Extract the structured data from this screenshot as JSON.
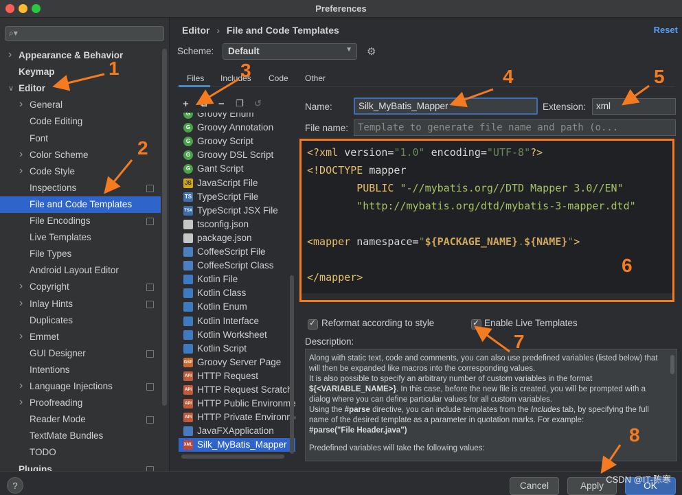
{
  "window": {
    "title": "Preferences"
  },
  "sidebar": {
    "search_placeholder": "",
    "items": [
      {
        "label": "Appearance & Behavior",
        "level": 0,
        "chevron": "right",
        "bold": true
      },
      {
        "label": "Keymap",
        "level": 0,
        "chevron": "",
        "bold": true
      },
      {
        "label": "Editor",
        "level": 0,
        "chevron": "down",
        "bold": true
      },
      {
        "label": "General",
        "level": 1,
        "chevron": "right"
      },
      {
        "label": "Code Editing",
        "level": 1,
        "chevron": ""
      },
      {
        "label": "Font",
        "level": 1,
        "chevron": ""
      },
      {
        "label": "Color Scheme",
        "level": 1,
        "chevron": "right"
      },
      {
        "label": "Code Style",
        "level": 1,
        "chevron": "right"
      },
      {
        "label": "Inspections",
        "level": 1,
        "chevron": "",
        "project": true
      },
      {
        "label": "File and Code Templates",
        "level": 1,
        "chevron": "",
        "selected": true
      },
      {
        "label": "File Encodings",
        "level": 1,
        "chevron": "",
        "project": true
      },
      {
        "label": "Live Templates",
        "level": 1,
        "chevron": ""
      },
      {
        "label": "File Types",
        "level": 1,
        "chevron": ""
      },
      {
        "label": "Android Layout Editor",
        "level": 1,
        "chevron": ""
      },
      {
        "label": "Copyright",
        "level": 1,
        "chevron": "right",
        "project": true
      },
      {
        "label": "Inlay Hints",
        "level": 1,
        "chevron": "right",
        "project": true
      },
      {
        "label": "Duplicates",
        "level": 1,
        "chevron": ""
      },
      {
        "label": "Emmet",
        "level": 1,
        "chevron": "right"
      },
      {
        "label": "GUI Designer",
        "level": 1,
        "chevron": "",
        "project": true
      },
      {
        "label": "Intentions",
        "level": 1,
        "chevron": ""
      },
      {
        "label": "Language Injections",
        "level": 1,
        "chevron": "right",
        "project": true
      },
      {
        "label": "Proofreading",
        "level": 1,
        "chevron": "right"
      },
      {
        "label": "Reader Mode",
        "level": 1,
        "chevron": "",
        "project": true
      },
      {
        "label": "TextMate Bundles",
        "level": 1,
        "chevron": ""
      },
      {
        "label": "TODO",
        "level": 1,
        "chevron": ""
      },
      {
        "label": "Plugins",
        "level": 0,
        "chevron": "",
        "bold": true,
        "project": true
      }
    ]
  },
  "header": {
    "breadcrumb_root": "Editor",
    "breadcrumb_sep": "›",
    "breadcrumb_page": "File and Code Templates",
    "reset": "Reset"
  },
  "scheme": {
    "label": "Scheme:",
    "value": "Default"
  },
  "tabs": [
    {
      "label": "Files",
      "active": true
    },
    {
      "label": "Includes"
    },
    {
      "label": "Code"
    },
    {
      "label": "Other"
    }
  ],
  "templates": [
    {
      "label": "Groovy Enum",
      "icon": "groovy",
      "glyph": "G"
    },
    {
      "label": "Groovy Annotation",
      "icon": "groovy",
      "glyph": "G"
    },
    {
      "label": "Groovy Script",
      "icon": "groovy",
      "glyph": "G"
    },
    {
      "label": "Groovy DSL Script",
      "icon": "groovy",
      "glyph": "G"
    },
    {
      "label": "Gant Script",
      "icon": "groovy",
      "glyph": "G"
    },
    {
      "label": "JavaScript File",
      "icon": "js",
      "glyph": "JS"
    },
    {
      "label": "TypeScript File",
      "icon": "ts",
      "glyph": "TS"
    },
    {
      "label": "TypeScript JSX File",
      "icon": "ts",
      "glyph": "TSX"
    },
    {
      "label": "tsconfig.json",
      "icon": "file",
      "glyph": ""
    },
    {
      "label": "package.json",
      "icon": "file",
      "glyph": ""
    },
    {
      "label": "CoffeeScript File",
      "icon": "coffee",
      "glyph": ""
    },
    {
      "label": "CoffeeScript Class",
      "icon": "coffee",
      "glyph": ""
    },
    {
      "label": "Kotlin File",
      "icon": "kotlin",
      "glyph": ""
    },
    {
      "label": "Kotlin Class",
      "icon": "kotlin",
      "glyph": ""
    },
    {
      "label": "Kotlin Enum",
      "icon": "kotlin",
      "glyph": ""
    },
    {
      "label": "Kotlin Interface",
      "icon": "kotlin",
      "glyph": ""
    },
    {
      "label": "Kotlin Worksheet",
      "icon": "kotlin",
      "glyph": ""
    },
    {
      "label": "Kotlin Script",
      "icon": "kotlin",
      "glyph": ""
    },
    {
      "label": "Groovy Server Page",
      "icon": "gsp",
      "glyph": "GSP"
    },
    {
      "label": "HTTP Request",
      "icon": "api",
      "glyph": "API"
    },
    {
      "label": "HTTP Request Scratch",
      "icon": "api",
      "glyph": "API"
    },
    {
      "label": "HTTP Public Environment",
      "icon": "api",
      "glyph": "API"
    },
    {
      "label": "HTTP Private Environment",
      "icon": "api",
      "glyph": "API"
    },
    {
      "label": "JavaFXApplication",
      "icon": "java",
      "glyph": ""
    },
    {
      "label": "Silk_MyBatis_Mapper",
      "icon": "xml",
      "glyph": "XML",
      "selected": true
    }
  ],
  "form": {
    "name_label": "Name:",
    "name_value": "Silk_MyBatis_Mapper",
    "ext_label": "Extension:",
    "ext_value": "xml",
    "filename_label": "File name:",
    "filename_placeholder": "Template to generate file name and path (o..."
  },
  "editor": {
    "lines": [
      [
        [
          "tag",
          "<?xml "
        ],
        [
          "attr",
          "version="
        ],
        [
          "str",
          "\"1.0\""
        ],
        [
          "attr",
          " encoding="
        ],
        [
          "str",
          "\"UTF-8\""
        ],
        [
          "tag",
          "?>"
        ]
      ],
      [
        [
          "tag",
          "<!DOCTYPE "
        ],
        [
          "attr",
          "mapper"
        ]
      ],
      [
        [
          "tag",
          "        PUBLIC "
        ],
        [
          "str2",
          "\"-//mybatis.org//DTD Mapper 3.0//EN\""
        ]
      ],
      [
        [
          "str2",
          "        \"http://mybatis.org/dtd/mybatis-3-mapper.dtd\""
        ]
      ],
      [],
      [
        [
          "tag",
          "<mapper "
        ],
        [
          "attr",
          "namespace="
        ],
        [
          "str",
          "\""
        ],
        [
          "var",
          "${PACKAGE_NAME}"
        ],
        [
          "str",
          "."
        ],
        [
          "var",
          "${NAME}"
        ],
        [
          "str",
          "\""
        ],
        [
          "tag",
          ">"
        ]
      ],
      [],
      [
        [
          "tag",
          "</mapper>"
        ]
      ]
    ]
  },
  "options": {
    "reformat_label": "Reformat according to style",
    "reformat_checked": true,
    "live_label": "Enable Live Templates",
    "live_checked": true
  },
  "description": {
    "label": "Description:",
    "p1": "Along with static text, code and comments, you can also use predefined variables (listed below) that will then be expanded like macros into the corresponding values.",
    "p2a": "It is also possible to specify an arbitrary number of custom variables in the format ",
    "p2b": "${<VARIABLE_NAME>}",
    "p2c": ". In this case, before the new file is created, you will be prompted with a dialog where you can define particular values for all custom variables.",
    "p3a": "Using the ",
    "p3b": "#parse",
    "p3c": " directive, you can include templates from the ",
    "p3d": "Includes",
    "p3e": " tab, by specifying the full name of the desired template as a parameter in quotation marks. For example:",
    "p3f": "#parse(\"File Header.java\")",
    "p4": "Predefined variables will take the following values:"
  },
  "buttons": {
    "help": "?",
    "cancel": "Cancel",
    "apply": "Apply",
    "ok": "OK"
  },
  "watermark": "CSDN @IT-陈寒",
  "annotations": [
    "1",
    "2",
    "3",
    "4",
    "5",
    "6",
    "7",
    "8"
  ],
  "colors": {
    "accent": "#2f65ca",
    "annotation": "#f47b20",
    "link": "#589df6"
  }
}
